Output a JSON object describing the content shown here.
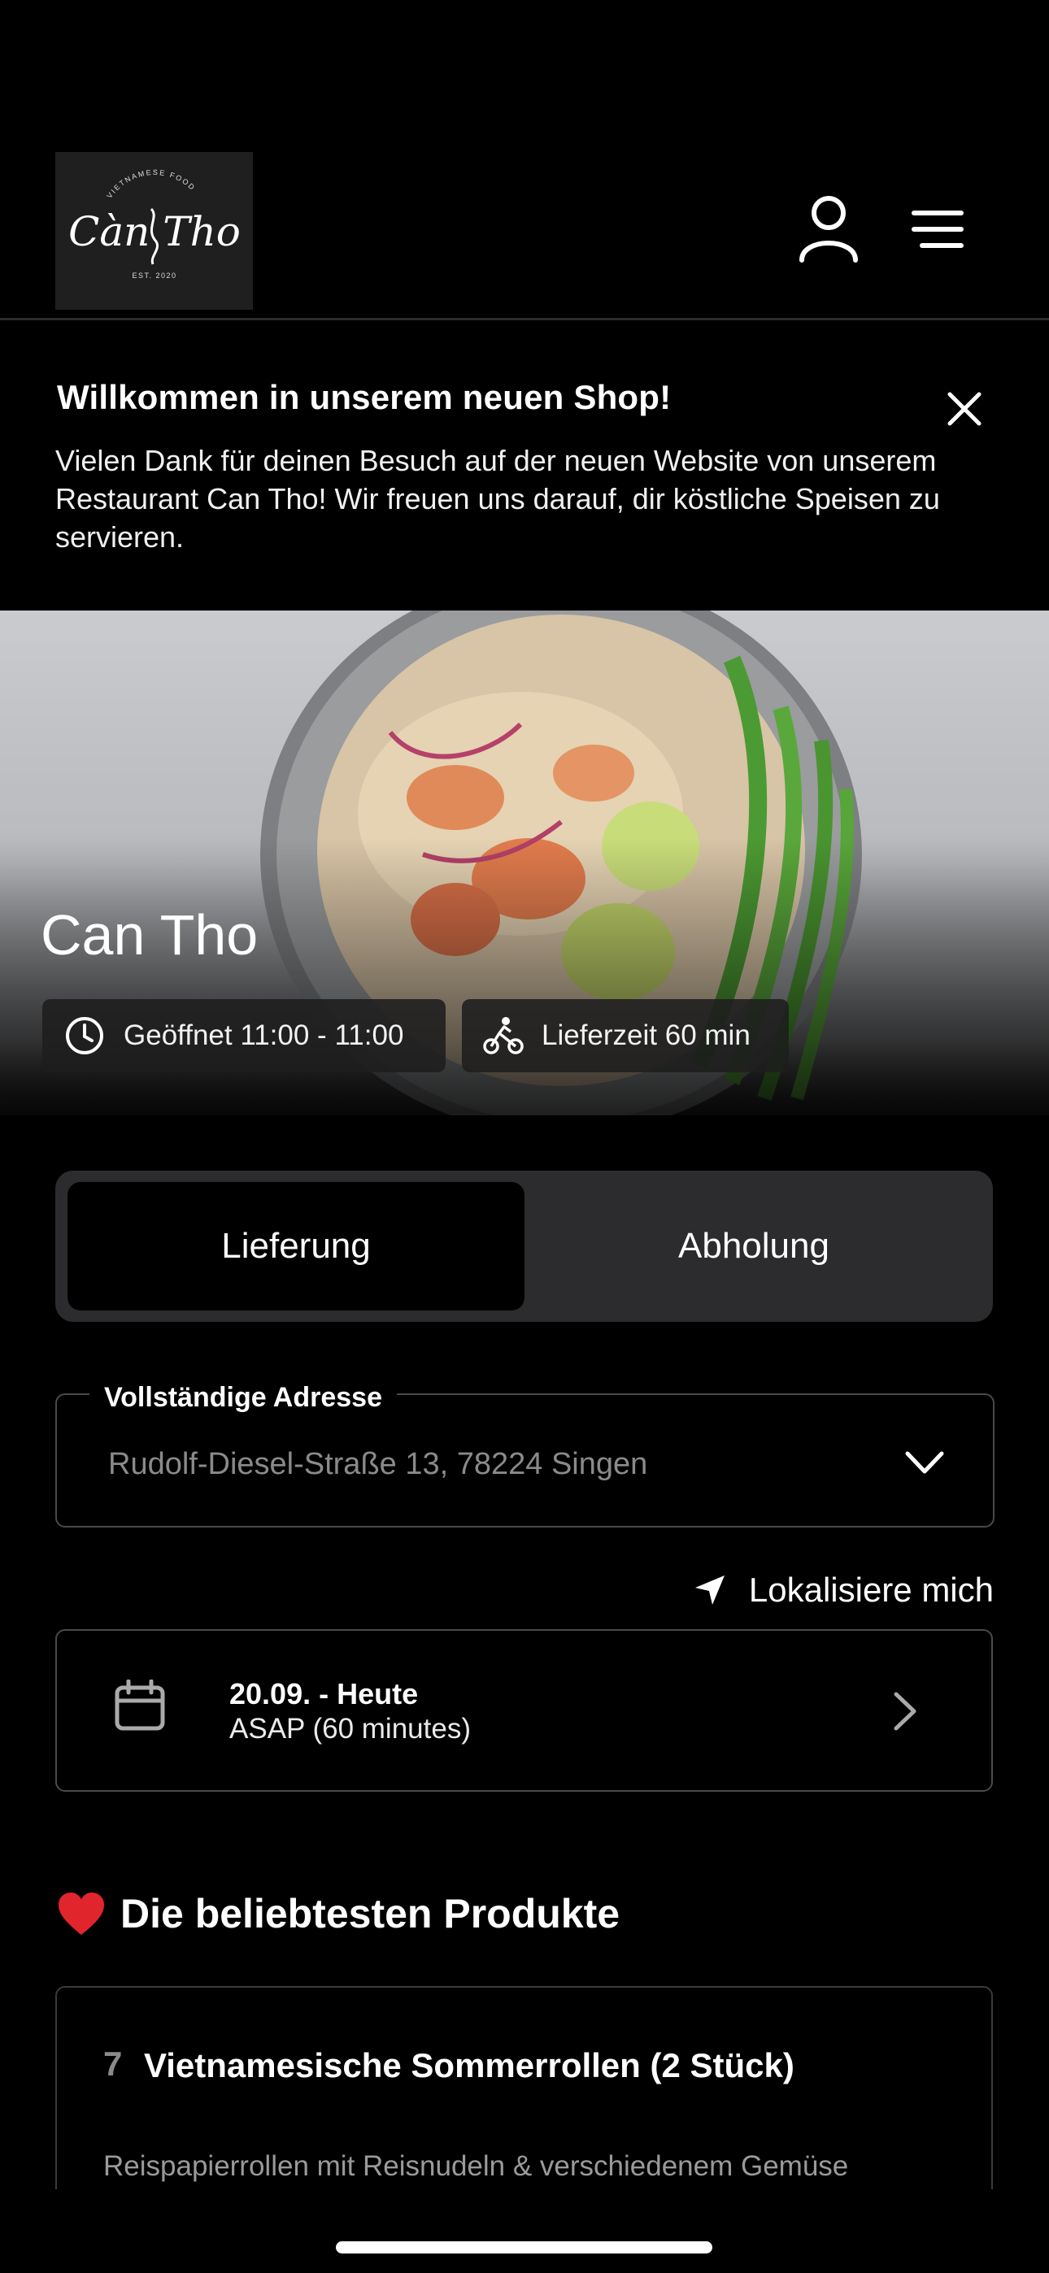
{
  "header": {
    "logo_top_text": "VIETNAMESE FOOD",
    "logo_script": "Càn Tho",
    "logo_est": "EST. 2020",
    "account_icon": "user-icon",
    "menu_icon": "hamburger-menu-icon"
  },
  "banner": {
    "title": "Willkommen in unserem neuen Shop!",
    "body": "Vielen Dank für deinen Besuch auf der neuen Website von unserem Restaurant Can Tho! Wir freuen uns darauf, dir köstliche Speisen zu servieren.",
    "close_icon": "close-icon"
  },
  "hero": {
    "restaurant_name": "Can Tho",
    "opening_hours": "Geöffnet 11:00 - 11:00",
    "delivery_time": "Lieferzeit 60 min"
  },
  "order_mode": {
    "delivery_label": "Lieferung",
    "pickup_label": "Abholung",
    "selected": "Lieferung"
  },
  "address": {
    "label": "Vollständige Adresse",
    "value": "Rudolf-Diesel-Straße 13, 78224 Singen"
  },
  "locate": {
    "label": "Lokalisiere mich"
  },
  "datetime": {
    "date": "20.09. - Heute",
    "time": "ASAP (60 minutes)"
  },
  "popular": {
    "heading": "Die beliebtesten Produkte",
    "items": [
      {
        "number": "7",
        "title": "Vietnamesische Sommerrollen (2 Stück)",
        "description": "Reispapierrollen mit Reisnudeln & verschiedenem Gemüse"
      }
    ]
  },
  "colors": {
    "background": "#000000",
    "segment_track": "#2c2c2e",
    "muted_text": "#8a8a8a",
    "heart": "#e0252c"
  }
}
